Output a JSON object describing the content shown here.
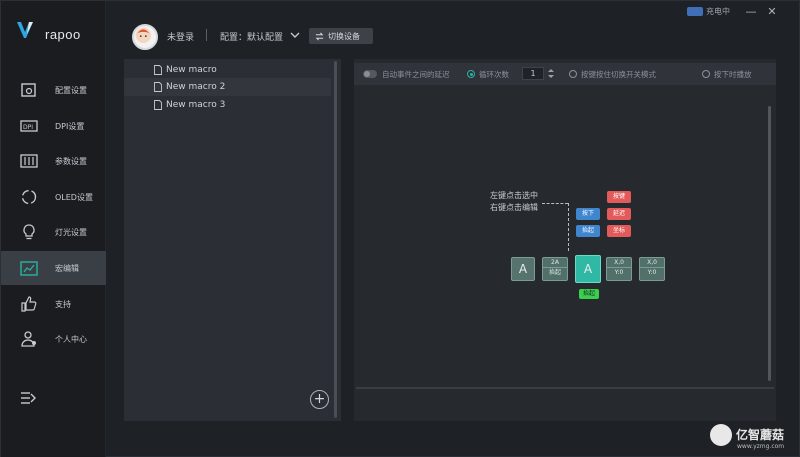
{
  "app": {
    "brand": "rapoo",
    "status_text": "充电中"
  },
  "header": {
    "user_name": "未登录",
    "config_label": "配置：默认配置",
    "switch_device_label": "切换设备"
  },
  "sidebar": {
    "items": [
      {
        "label": "配置设置",
        "icon": "config-icon"
      },
      {
        "label": "DPI设置",
        "icon": "dpi-icon"
      },
      {
        "label": "参数设置",
        "icon": "params-icon"
      },
      {
        "label": "OLED设置",
        "icon": "oled-icon"
      },
      {
        "label": "灯光设置",
        "icon": "bulb-icon"
      },
      {
        "label": "宏编辑",
        "icon": "macro-icon",
        "active": true
      },
      {
        "label": "支持",
        "icon": "thumbs-up-icon"
      },
      {
        "label": "个人中心",
        "icon": "user-icon"
      }
    ]
  },
  "macros": {
    "items": [
      "New macro",
      "New macro 2",
      "New macro 3"
    ]
  },
  "editor": {
    "toolbar": {
      "record_delay_label": "自动事件之间的延迟",
      "loop_label": "循环次数",
      "loop_count": "1",
      "hold_label": "按键按住切换开关模式",
      "release_label": "按下时播放"
    },
    "diagram": {
      "hint_line1": "左键点击选中",
      "hint_line2": "右键点击编辑",
      "red_boxes": [
        "按键",
        "延迟",
        "坐标"
      ],
      "blue_boxes": [
        "按下",
        "抬起"
      ],
      "key_left": "A",
      "key_center": "A",
      "key_sm1_top": "2A",
      "key_sm1_bottom": "抬起",
      "key_sm2_top": "X,0",
      "key_sm2_bottom": "Y:0",
      "key_sm3_top": "X,0",
      "key_sm3_bottom": "Y:0",
      "green_label": "抬起"
    }
  },
  "watermark": {
    "text": "亿智蘑菇",
    "url": "www.yzmg.com"
  },
  "colors": {
    "accent": "#2ab3a2",
    "red": "#e35a5a",
    "blue": "#3f86cf",
    "green": "#3bd04b"
  }
}
